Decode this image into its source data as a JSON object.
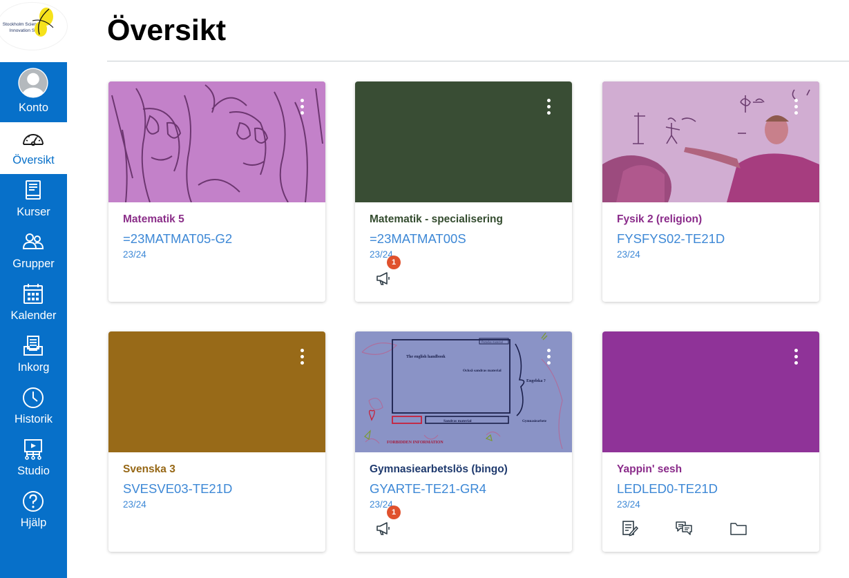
{
  "logo": {
    "line1": "Stockholm Science &",
    "line2": "Innovation School"
  },
  "nav": {
    "items": [
      {
        "label": "Konto"
      },
      {
        "label": "Översikt"
      },
      {
        "label": "Kurser"
      },
      {
        "label": "Grupper"
      },
      {
        "label": "Kalender"
      },
      {
        "label": "Inkorg"
      },
      {
        "label": "Historik"
      },
      {
        "label": "Studio"
      },
      {
        "label": "Hjälp"
      }
    ]
  },
  "page": {
    "title": "Översikt"
  },
  "cards": [
    {
      "name": "Matematik 5",
      "code": "=23MATMAT05-G2",
      "term": "23/24",
      "color": "#9e3a9e",
      "hero": "sketch-image"
    },
    {
      "name": "Matematik - specialisering",
      "code": "=23MATMAT00S",
      "term": "23/24",
      "color": "#344c2f",
      "hero": "solid",
      "badge": "1"
    },
    {
      "name": "Fysik 2 (religion)",
      "code": "FYSFYS02-TE21D",
      "term": "23/24",
      "color": "#8a2b8a",
      "hero": "classroom-photo"
    },
    {
      "name": "Svenska 3",
      "code": "SVESVE03-TE21D",
      "term": "23/24",
      "color": "#966715",
      "hero": "solid"
    },
    {
      "name": "Gymnasiearbetslös (bingo)",
      "code": "GYARTE-TE21-GR4",
      "term": "23/24",
      "color": "#1f3a6e",
      "hero": "whiteboard-drawing",
      "badge": "1",
      "hero_text": {
        "title": "The english handbook",
        "note": "Också sandras material",
        "english": "Engelska ?",
        "sandra": "Sandras material",
        "gym": "Gymnasiearbete",
        "forbidden": "FORBIDDEN INFORMATION",
        "tag": "Pamelas material"
      }
    },
    {
      "name": "Yappin' sesh",
      "code": "LEDLED0-TE21D",
      "term": "23/24",
      "color": "#8f3398",
      "hero": "solid"
    }
  ],
  "colors": {
    "nav_bg": "#0770c9",
    "link": "#3d88d6",
    "badge": "#e0512d",
    "hero_purple": "#c381c9",
    "hero_green": "#394d34",
    "hero_mustard": "#986a18",
    "hero_blue": "#8590c4",
    "hero_magenta": "#8f3398"
  },
  "icons": {
    "announcement": "megaphone-icon",
    "assignments": "assignment-icon",
    "discussions": "discussion-icon",
    "files": "folder-icon"
  }
}
